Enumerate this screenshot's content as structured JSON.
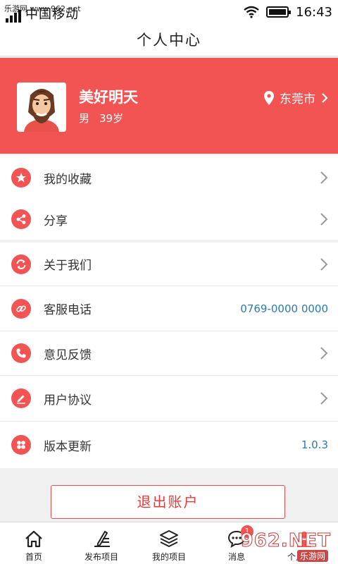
{
  "status_bar": {
    "watermark": "乐游网 www.962.net",
    "carrier": "中国移动",
    "time": "16:43"
  },
  "nav": {
    "title": "个人中心"
  },
  "profile": {
    "name": "美好明天",
    "gender": "男",
    "age": "39岁",
    "city": "东莞市"
  },
  "menu": {
    "favorites": {
      "label": "我的收藏",
      "icon": "star-icon"
    },
    "share": {
      "label": "分享",
      "icon": "share-icon"
    },
    "about": {
      "label": "关于我们",
      "icon": "refresh-icon"
    },
    "service": {
      "label": "客服电话",
      "value": "0769-0000 0000",
      "icon": "link-icon"
    },
    "feedback": {
      "label": "意见反馈",
      "icon": "phone-icon"
    },
    "agreement": {
      "label": "用户协议",
      "icon": "pen-icon"
    },
    "version": {
      "label": "版本更新",
      "value": "1.0.3",
      "icon": "grid-icon"
    }
  },
  "logout_label": "退出账户",
  "tabs": [
    {
      "label": "首页",
      "icon": "home-icon"
    },
    {
      "label": "发布项目",
      "icon": "edit-icon"
    },
    {
      "label": "我的项目",
      "icon": "layers-icon"
    },
    {
      "label": "消息",
      "icon": "message-icon",
      "badge": "1"
    },
    {
      "label": "个人中心",
      "icon": "user-icon"
    }
  ],
  "watermark_logo": {
    "text": "962.NET",
    "sub": "乐游网"
  },
  "colors": {
    "accent": "#f25353",
    "value_blue": "#2a7ab0"
  }
}
